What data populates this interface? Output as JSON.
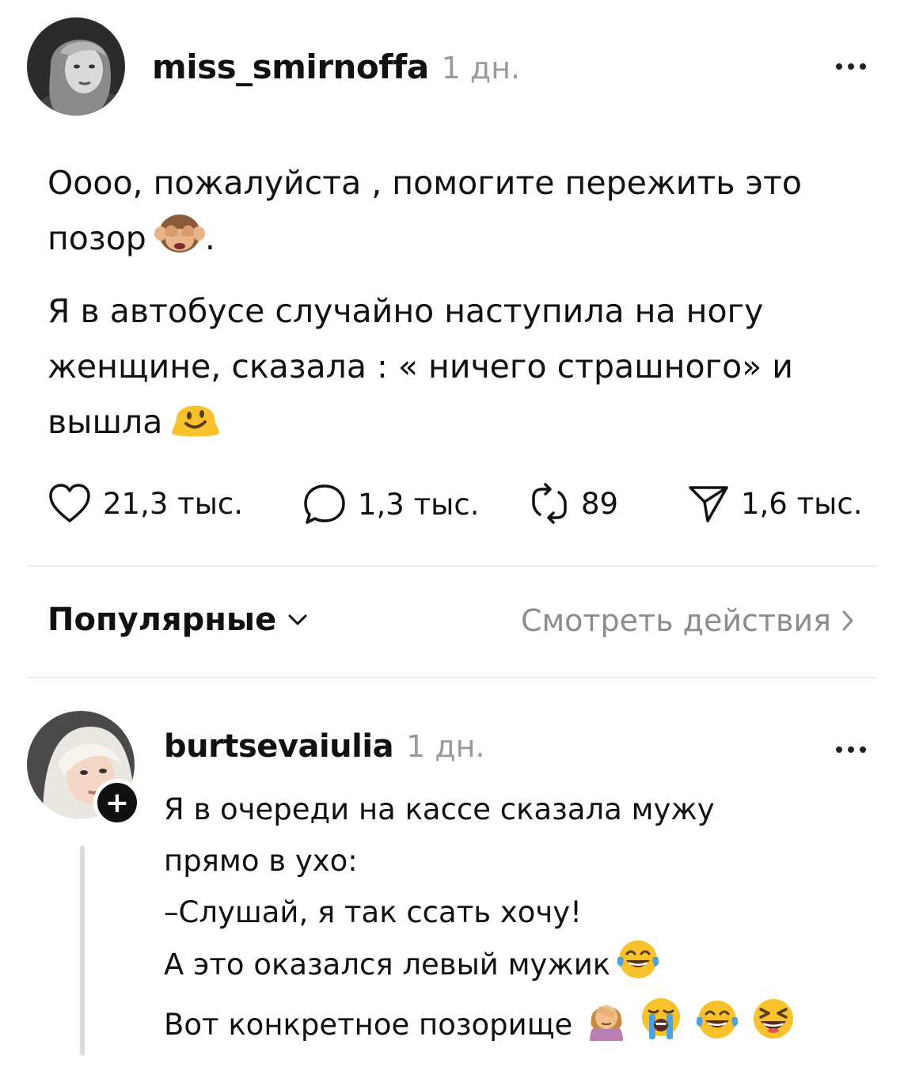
{
  "post": {
    "author": "miss_smirnoffa",
    "time": "1 дн.",
    "paragraph1": "Оооо, пожалуйста , помогите пережить это позор",
    "paragraph1_emoji": "see-no-evil-monkey",
    "paragraph1_end": ".",
    "paragraph2": "Я в автобусе случайно наступила на ногу женщине, сказала : « ничего страшного» и вышла",
    "paragraph2_emoji": "melting-face"
  },
  "actions": {
    "likes": "21,3 тыс.",
    "replies": "1,3 тыс.",
    "reposts": "89",
    "shares": "1,6 тыс."
  },
  "sort": {
    "label": "Популярные",
    "view_activity": "Смотреть действия"
  },
  "comment": {
    "author": "burtsevaiulia",
    "time": "1 дн.",
    "lines": [
      "Я в очереди на кассе сказала мужу",
      "прямо в ухо:",
      "–Слушай, я так ссать хочу!",
      "А это оказался левый мужик",
      "Вот конкретное позорище"
    ],
    "line4_emoji": "face-with-tears-of-joy",
    "line5_emojis": [
      "woman-facepalming",
      "loudly-crying-face",
      "face-with-tears-of-joy",
      "grinning-squinting-face"
    ],
    "follow_symbol": "+"
  },
  "colors": {
    "text": "#111111",
    "muted": "#9a9a9a",
    "divider": "#ececec",
    "emoji_yellow": "#f7c22b"
  }
}
